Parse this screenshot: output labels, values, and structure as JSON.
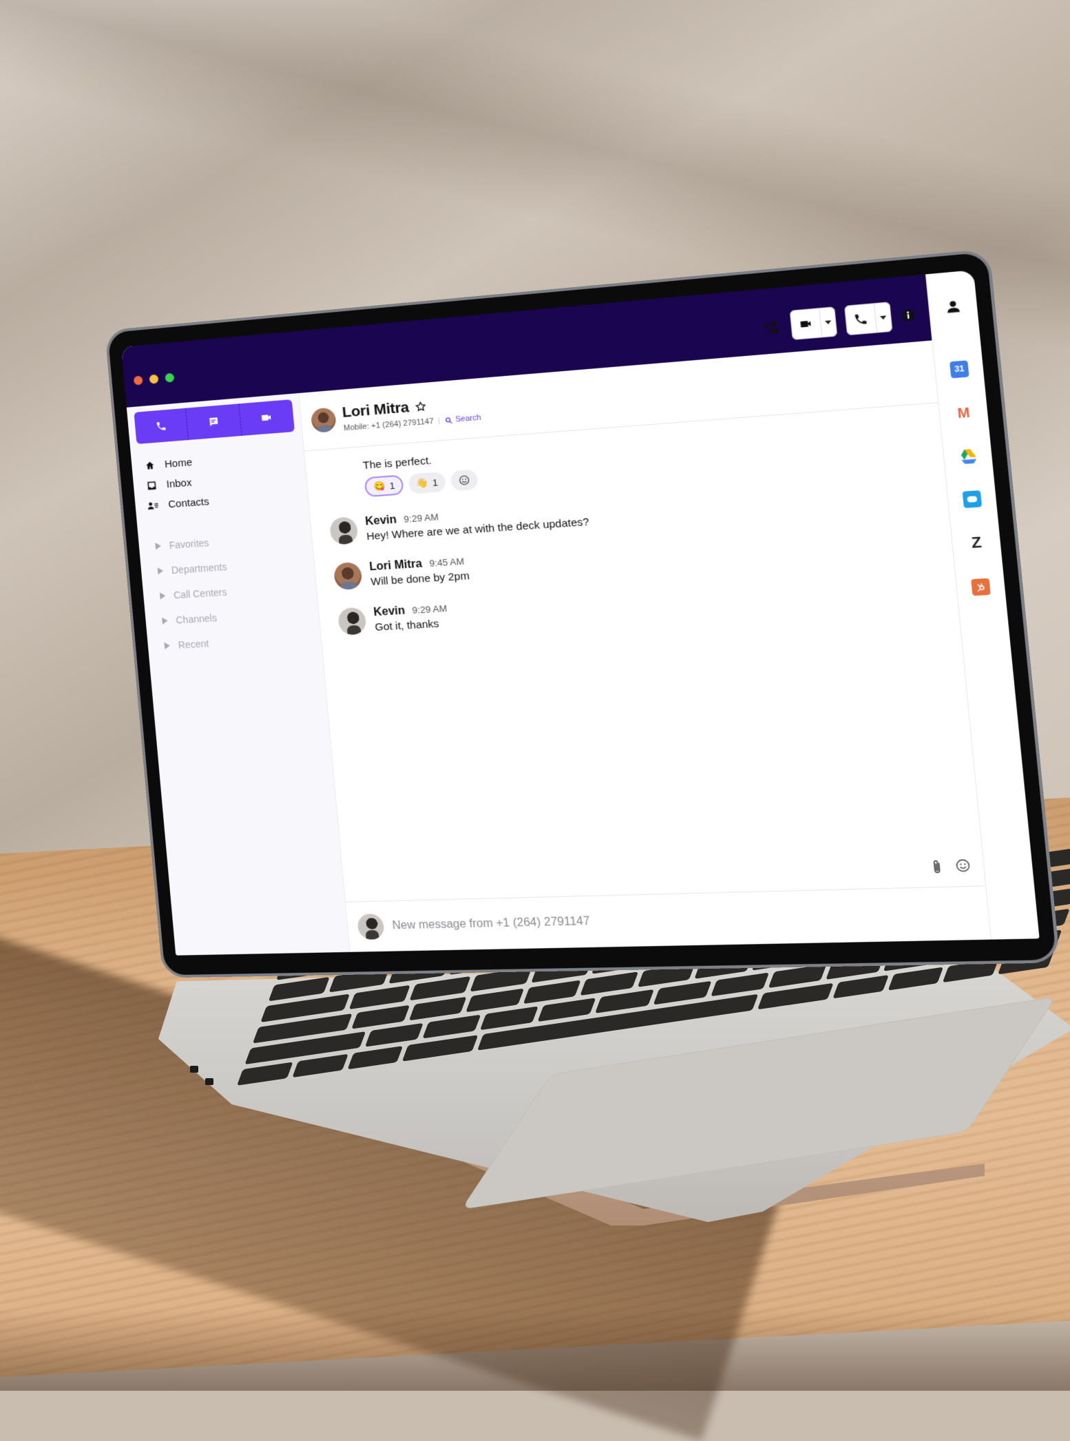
{
  "window": {
    "traffic_lights": [
      "close",
      "minimize",
      "zoom"
    ],
    "colors": {
      "titlebar": "#190550",
      "accent": "#6b3cf6",
      "close": "#ee6b3d",
      "minimize": "#f5c242",
      "zoom": "#39d34b"
    }
  },
  "sidebar": {
    "mode_buttons": [
      {
        "name": "phone",
        "icon": "phone-icon"
      },
      {
        "name": "messages",
        "icon": "chat-icon"
      },
      {
        "name": "video",
        "icon": "video-icon"
      }
    ],
    "nav": [
      {
        "label": "Home",
        "icon": "home-icon"
      },
      {
        "label": "Inbox",
        "icon": "inbox-icon"
      },
      {
        "label": "Contacts",
        "icon": "contacts-icon"
      }
    ],
    "groups": [
      {
        "label": "Favorites"
      },
      {
        "label": "Departments"
      },
      {
        "label": "Call Centers"
      },
      {
        "label": "Channels"
      },
      {
        "label": "Recent"
      }
    ]
  },
  "header": {
    "contact_name": "Lori Mitra",
    "favorite_icon": "star-outline-icon",
    "subtitle": "Mobile: +1 (264) 2791147",
    "search_label": "Search",
    "actions": {
      "add_person": "add-person-icon",
      "video": "video-icon",
      "call": "phone-icon",
      "info": "info-icon"
    }
  },
  "messages": {
    "first_text": "The is perfect.",
    "reactions": [
      {
        "emoji": "😋",
        "count": "1",
        "active": true
      },
      {
        "emoji": "👋",
        "count": "1",
        "active": false
      },
      {
        "emoji": "☺",
        "count": "",
        "add": true
      }
    ],
    "items": [
      {
        "author": "Kevin",
        "time": "9:29 AM",
        "text": "Hey! Where are we at with the deck updates?",
        "avatar": "kevin"
      },
      {
        "author": "Lori Mitra",
        "time": "9:45 AM",
        "text": "Will be done by 2pm",
        "avatar": "lori"
      },
      {
        "author": "Kevin",
        "time": "9:29 AM",
        "text": "Got it, thanks",
        "avatar": "kevin"
      }
    ]
  },
  "composer": {
    "placeholder": "New message from +1 (264) 2791147",
    "value": "",
    "tools": [
      "attachment-icon",
      "emoji-icon"
    ]
  },
  "right_rail": {
    "items": [
      {
        "name": "contact-details",
        "icon": "person-icon"
      },
      {
        "name": "google-calendar",
        "icon": "calendar-icon",
        "label": "31",
        "color": "#3f7ee8"
      },
      {
        "name": "gmail",
        "icon": "gmail-icon",
        "label": "M",
        "color": "#e4683f"
      },
      {
        "name": "google-drive",
        "icon": "drive-icon",
        "color": "#f4b400"
      },
      {
        "name": "salesforce",
        "icon": "salesforce-icon",
        "color": "#1ea0e6"
      },
      {
        "name": "zendesk",
        "icon": "zendesk-icon",
        "label": "Z",
        "color": "#222222"
      },
      {
        "name": "hubspot",
        "icon": "hubspot-icon",
        "color": "#e8703c"
      }
    ]
  }
}
